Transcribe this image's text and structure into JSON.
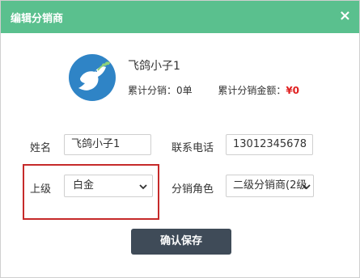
{
  "dialog": {
    "title": "编辑分销商",
    "close_glyph": "×"
  },
  "profile": {
    "display_name": "飞鸽小子1",
    "sales_label": "累计分销：",
    "sales_value": "0单",
    "amount_label": "累计分销金额：",
    "amount_value": "¥0",
    "avatar_icon": "dove-icon",
    "avatar_color": "#2f84c6",
    "amount_color": "#e01f1f"
  },
  "form": {
    "name_label": "姓名",
    "name_value": "飞鸽小子1",
    "phone_label": "联系电话",
    "phone_value": "13012345678",
    "level_label": "上级",
    "level_value": "白金",
    "role_label": "分销角色",
    "role_value": "二级分销商(2级"
  },
  "actions": {
    "save_label": "确认保存"
  },
  "colors": {
    "header": "#5ac08e",
    "button": "#3f4b58",
    "highlight": "#c62a2a"
  }
}
